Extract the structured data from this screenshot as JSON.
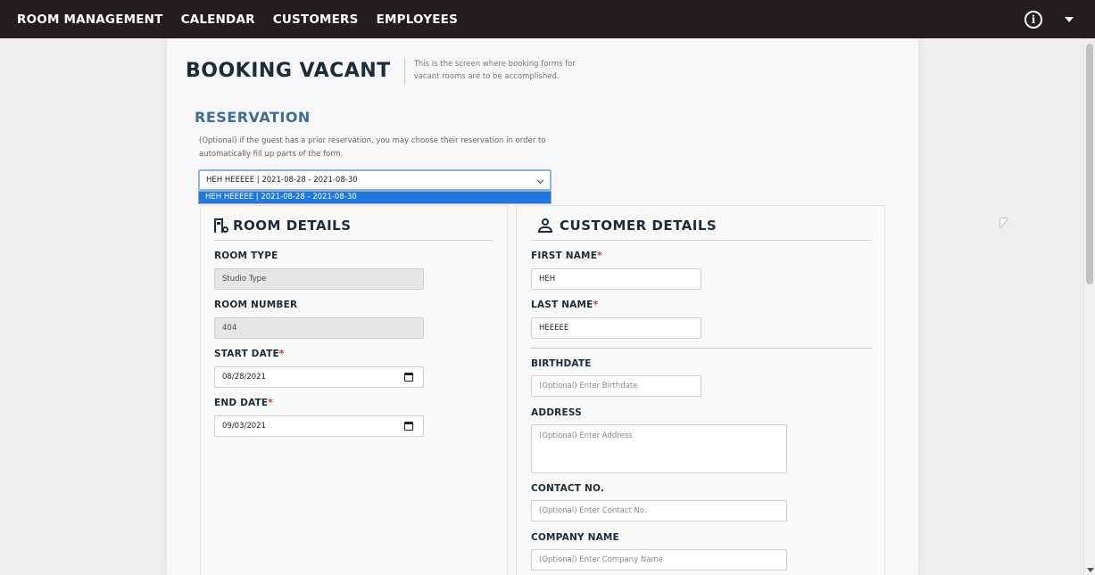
{
  "nav": {
    "links": [
      "ROOM MANAGEMENT",
      "CALENDAR",
      "CUSTOMERS",
      "EMPLOYEES"
    ],
    "info_icon": "info-circle-icon",
    "menu_icon": "caret-down-icon",
    "info_glyph": "i"
  },
  "header": {
    "title": "BOOKING VACANT",
    "subtitle": "This is the screen where booking forms for vacant rooms are to be accomplished."
  },
  "reservation": {
    "title": "RESERVATION",
    "description": "(Optional) if the guest has a prior reservation, you may choose their reservation in order to automatically fill up parts of the form.",
    "selected": "HEH HEEEEE | 2021-08-28 - 2021-08-30",
    "options": [
      "HEH HEEEEE | 2021-08-28 - 2021-08-30"
    ]
  },
  "room_details": {
    "title": "ROOM DETAILS",
    "icon": "building-icon",
    "room_type_label": "ROOM TYPE",
    "room_type_value": "Studio Type",
    "room_number_label": "ROOM NUMBER",
    "room_number_value": "404",
    "start_date_label": "START DATE",
    "start_date_value": "08/28/2021",
    "end_date_label": "END DATE",
    "end_date_value": "09/03/2021",
    "required_mark": "*"
  },
  "customer_details": {
    "title": "CUSTOMER DETAILS",
    "icon": "person-icon",
    "first_name_label": "FIRST NAME",
    "first_name_value": "HEH",
    "last_name_label": "LAST NAME",
    "last_name_value": "HEEEEE",
    "birthdate_label": "BIRTHDATE",
    "birthdate_placeholder": "(Optional) Enter Birthdate",
    "address_label": "ADDRESS",
    "address_placeholder": "(Optional) Enter Address",
    "contact_label": "CONTACT NO.",
    "contact_placeholder": "(Optional) Enter Contact No.",
    "company_label": "COMPANY NAME",
    "company_placeholder": "(Optional) Enter Company Name",
    "required_mark": "*"
  },
  "colors": {
    "navbar": "#231f20",
    "section_title": "#3e6c97",
    "required": "#d0312d",
    "selected_option": "#1e78e0"
  }
}
